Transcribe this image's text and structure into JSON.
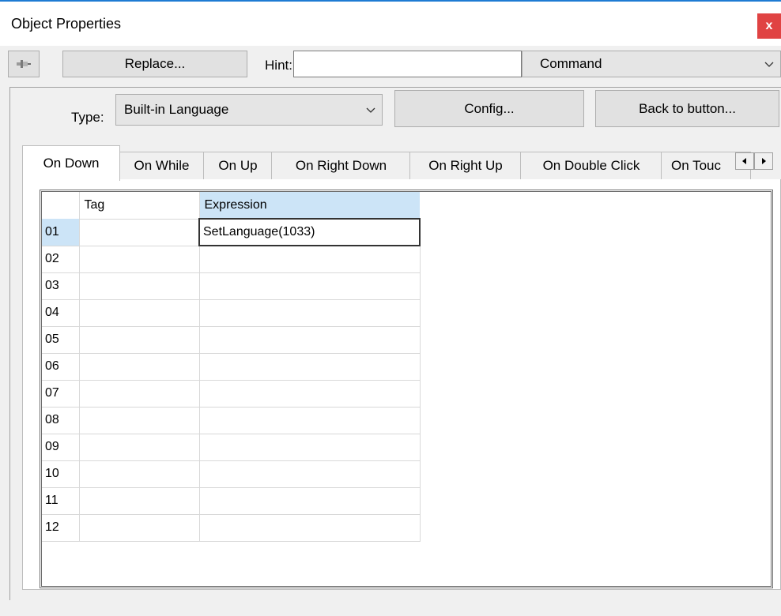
{
  "window": {
    "title": "Object Properties",
    "close_label": "x"
  },
  "toolbar": {
    "pin_icon": "pushpin-icon",
    "replace_label": "Replace...",
    "hint_label": "Hint:",
    "hint_value": "",
    "command_value": "Command"
  },
  "type_row": {
    "type_label": "Type:",
    "type_value": "Built-in Language",
    "config_label": "Config...",
    "back_label": "Back to button..."
  },
  "tabs": [
    {
      "label": "On Down",
      "active": true
    },
    {
      "label": "On While"
    },
    {
      "label": "On Up"
    },
    {
      "label": "On Right Down"
    },
    {
      "label": "On Right Up"
    },
    {
      "label": "On Double Click"
    },
    {
      "label": "On Touc"
    }
  ],
  "grid": {
    "columns": [
      "Tag",
      "Expression"
    ],
    "rows": [
      {
        "num": "01",
        "tag": "",
        "expression": "SetLanguage(1033)"
      },
      {
        "num": "02",
        "tag": "",
        "expression": ""
      },
      {
        "num": "03",
        "tag": "",
        "expression": ""
      },
      {
        "num": "04",
        "tag": "",
        "expression": ""
      },
      {
        "num": "05",
        "tag": "",
        "expression": ""
      },
      {
        "num": "06",
        "tag": "",
        "expression": ""
      },
      {
        "num": "07",
        "tag": "",
        "expression": ""
      },
      {
        "num": "08",
        "tag": "",
        "expression": ""
      },
      {
        "num": "09",
        "tag": "",
        "expression": ""
      },
      {
        "num": "10",
        "tag": "",
        "expression": ""
      },
      {
        "num": "11",
        "tag": "",
        "expression": ""
      },
      {
        "num": "12",
        "tag": "",
        "expression": ""
      }
    ]
  },
  "colors": {
    "accent": "#1e7bd3",
    "close_bg": "#e04343",
    "selection": "#cce4f7"
  }
}
